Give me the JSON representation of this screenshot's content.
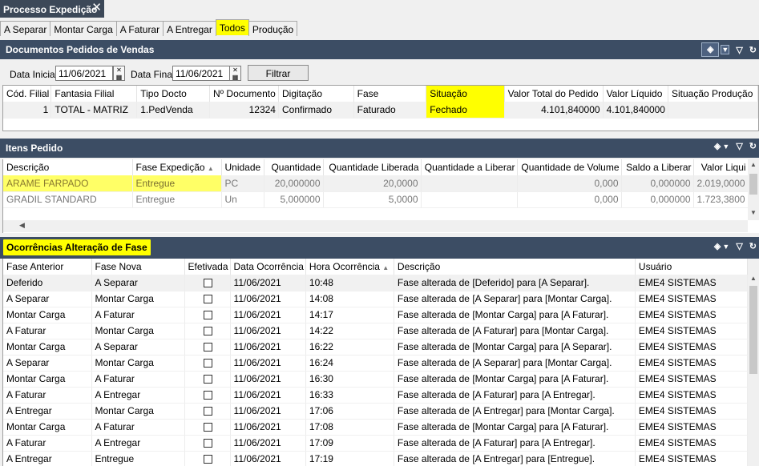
{
  "window": {
    "tab_title": "Processo Expedição"
  },
  "tabs": [
    {
      "label": "A Separar"
    },
    {
      "label": "Montar Carga"
    },
    {
      "label": "A Faturar"
    },
    {
      "label": "A Entregar"
    },
    {
      "label": "Todos"
    },
    {
      "label": "Produção"
    }
  ],
  "documentos": {
    "title": "Documentos Pedidos de Vendas",
    "filter": {
      "data_inicial_label": "Data Inicial:",
      "data_inicial": "11/06/2021",
      "data_final_label": "Data Final:",
      "data_final": "11/06/2021",
      "filtrar_label": "Filtrar"
    },
    "columns": [
      "Cód. Filial",
      "Fantasia Filial",
      "Tipo Docto",
      "Nº Documento",
      "Digitação",
      "Fase",
      "Situação",
      "Valor Total do Pedido",
      "Valor Líquido",
      "Situação Produção"
    ],
    "rows": [
      [
        "1",
        "TOTAL - MATRIZ",
        "1.PedVenda",
        "12324",
        "Confirmado",
        "Faturado",
        "Fechado",
        "4.101,840000",
        "4.101,840000",
        ""
      ]
    ]
  },
  "itens": {
    "title": "Itens Pedido",
    "columns": [
      "Descrição",
      "Fase Expedição",
      "Unidade",
      "Quantidade",
      "Quantidade Liberada",
      "Quantidade a Liberar",
      "Quantidade de Volume",
      "Saldo a Liberar",
      "Valor Liqui"
    ],
    "rows": [
      [
        "ARAME FARPADO",
        "Entregue",
        "PC",
        "20,000000",
        "20,0000",
        "",
        "0,000",
        "0,000000",
        "2.019,0000"
      ],
      [
        "GRADIL STANDARD",
        "Entregue",
        "Un",
        "5,000000",
        "5,0000",
        "",
        "0,000",
        "0,000000",
        "1.723,3800"
      ]
    ]
  },
  "ocorrencias": {
    "title": "Ocorrências Alteração de Fase",
    "columns": [
      "Fase Anterior",
      "Fase Nova",
      "Efetivada",
      "Data Ocorrência",
      "Hora Ocorrência",
      "Descrição",
      "Usuário"
    ],
    "rows": [
      [
        "Deferido",
        "A Separar",
        "11/06/2021",
        "10:48",
        "Fase alterada de [Deferido] para [A Separar].",
        "EME4 SISTEMAS"
      ],
      [
        "A Separar",
        "Montar Carga",
        "11/06/2021",
        "14:08",
        "Fase alterada de [A Separar] para [Montar Carga].",
        "EME4 SISTEMAS"
      ],
      [
        "Montar Carga",
        "A Faturar",
        "11/06/2021",
        "14:17",
        "Fase alterada de [Montar Carga] para [A Faturar].",
        "EME4 SISTEMAS"
      ],
      [
        "A Faturar",
        "Montar Carga",
        "11/06/2021",
        "14:22",
        "Fase alterada de [A Faturar] para [Montar Carga].",
        "EME4 SISTEMAS"
      ],
      [
        "Montar Carga",
        "A Separar",
        "11/06/2021",
        "16:22",
        "Fase alterada de [Montar Carga] para [A Separar].",
        "EME4 SISTEMAS"
      ],
      [
        "A Separar",
        "Montar Carga",
        "11/06/2021",
        "16:24",
        "Fase alterada de [A Separar] para [Montar Carga].",
        "EME4 SISTEMAS"
      ],
      [
        "Montar Carga",
        "A Faturar",
        "11/06/2021",
        "16:30",
        "Fase alterada de [Montar Carga] para [A Faturar].",
        "EME4 SISTEMAS"
      ],
      [
        "A Faturar",
        "A Entregar",
        "11/06/2021",
        "16:33",
        "Fase alterada de [A Faturar] para [A Entregar].",
        "EME4 SISTEMAS"
      ],
      [
        "A Entregar",
        "Montar Carga",
        "11/06/2021",
        "17:06",
        "Fase alterada de [A Entregar] para [Montar Carga].",
        "EME4 SISTEMAS"
      ],
      [
        "Montar Carga",
        "A Faturar",
        "11/06/2021",
        "17:08",
        "Fase alterada de [Montar Carga] para [A Faturar].",
        "EME4 SISTEMAS"
      ],
      [
        "A Faturar",
        "A Entregar",
        "11/06/2021",
        "17:09",
        "Fase alterada de [A Faturar] para [A Entregar].",
        "EME4 SISTEMAS"
      ],
      [
        "A Entregar",
        "Entregue",
        "11/06/2021",
        "17:19",
        "Fase alterada de [A Entregar] para [Entregue].",
        "EME4 SISTEMAS"
      ]
    ]
  }
}
